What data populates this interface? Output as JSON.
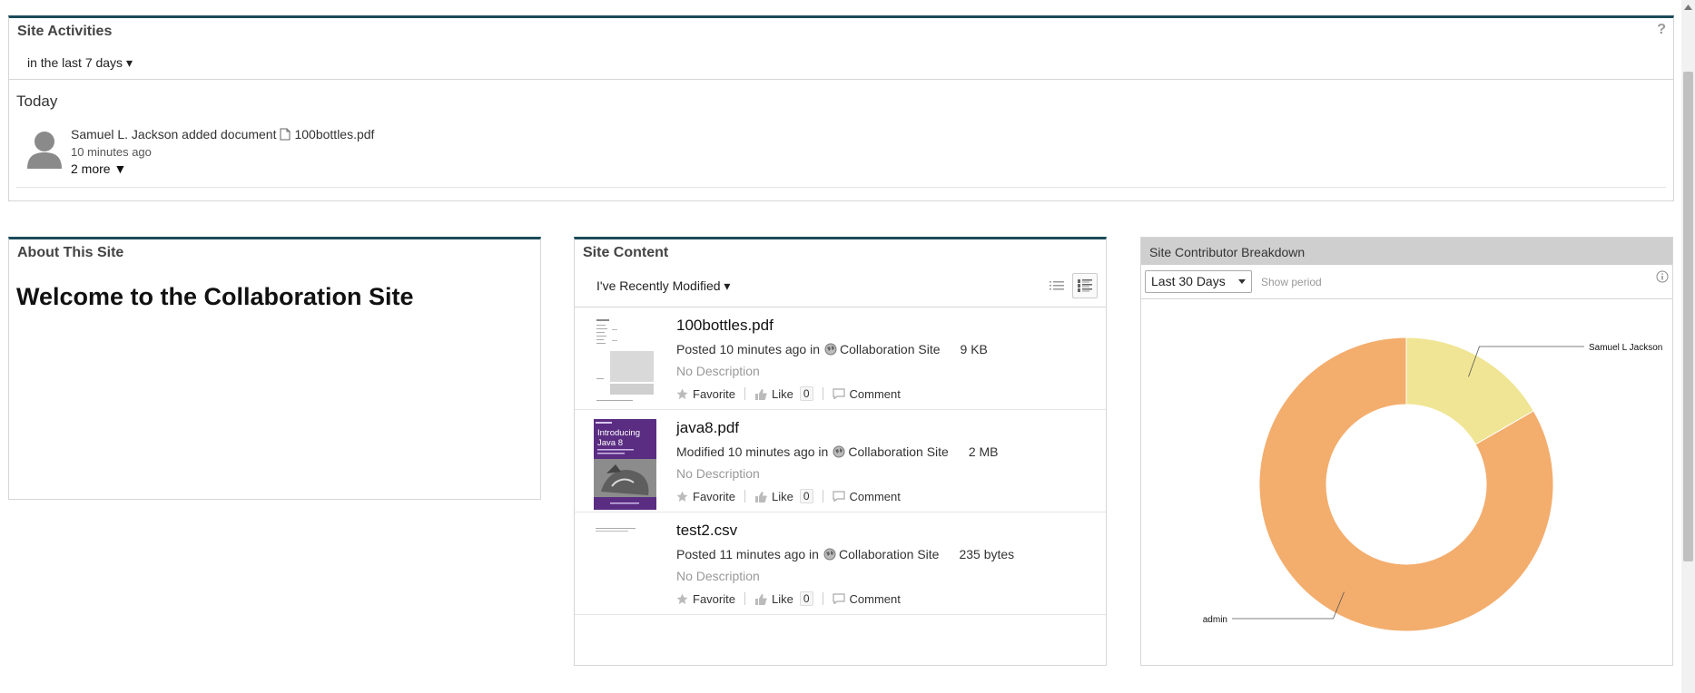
{
  "activities": {
    "title": "Site Activities",
    "help": "?",
    "filter": "in the last 7 days ▾",
    "day": "Today",
    "entry": {
      "text": "Samuel L. Jackson added document",
      "document": "100bottles.pdf",
      "time": "10 minutes ago",
      "more": "2 more ▼"
    }
  },
  "about": {
    "title": "About This Site",
    "heading": "Welcome to the Collaboration Site"
  },
  "content": {
    "title": "Site Content",
    "filter": "I've Recently Modified ▾",
    "items": [
      {
        "name": "100bottles.pdf",
        "action": "Posted 10 minutes ago in",
        "site": "Collaboration Site",
        "size": "9 KB",
        "description": "No Description",
        "favorite": "Favorite",
        "like": "Like",
        "like_count": "0",
        "comment": "Comment"
      },
      {
        "name": "java8.pdf",
        "action": "Modified 10 minutes ago in",
        "site": "Collaboration Site",
        "size": "2 MB",
        "description": "No Description",
        "favorite": "Favorite",
        "like": "Like",
        "like_count": "0",
        "comment": "Comment",
        "thumb_text": "Introducing Java 8"
      },
      {
        "name": "test2.csv",
        "action": "Posted 11 minutes ago in",
        "site": "Collaboration Site",
        "size": "235 bytes",
        "description": "No Description",
        "favorite": "Favorite",
        "like": "Like",
        "like_count": "0",
        "comment": "Comment"
      }
    ]
  },
  "contributors": {
    "title": "Site Contributor Breakdown",
    "period": "Last 30 Days",
    "show_period": "Show period",
    "colors": {
      "samuel": "#f0e594",
      "admin": "#f3ad6d"
    }
  },
  "chart_data": {
    "type": "pie",
    "categories": [
      "Samuel L Jackson",
      "admin"
    ],
    "values": [
      1,
      5
    ]
  }
}
